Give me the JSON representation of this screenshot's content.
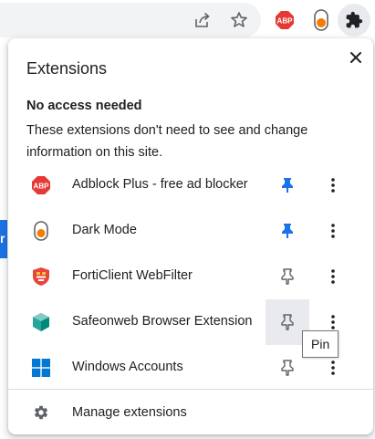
{
  "colors": {
    "accent": "#1a73e8",
    "icon_gray": "#5f6368",
    "text": "#202124",
    "abp_red": "#e53935",
    "dark_mode_orange": "#f57c00"
  },
  "toolbar": {
    "icons": [
      "share-icon",
      "bookmark-star-icon",
      "adblock-plus-icon",
      "dark-mode-icon",
      "extensions-puzzle-icon"
    ]
  },
  "popup": {
    "title": "Extensions",
    "close_icon": "close-icon",
    "section": {
      "heading": "No access needed",
      "description": "These extensions don't need to see and change information on this site."
    },
    "extensions": [
      {
        "name": "Adblock Plus - free ad blocker",
        "icon": "adblock-plus-icon",
        "pinned": true
      },
      {
        "name": "Dark Mode",
        "icon": "dark-mode-icon",
        "pinned": true
      },
      {
        "name": "FortiClient WebFilter",
        "icon": "forticlient-icon",
        "pinned": false
      },
      {
        "name": "Safeonweb Browser Extension",
        "icon": "safeonweb-icon",
        "pinned": false
      },
      {
        "name": "Windows Accounts",
        "icon": "windows-icon",
        "pinned": false
      }
    ],
    "tooltip": "Pin",
    "manage_label": "Manage extensions"
  },
  "abp_label": "ABP"
}
